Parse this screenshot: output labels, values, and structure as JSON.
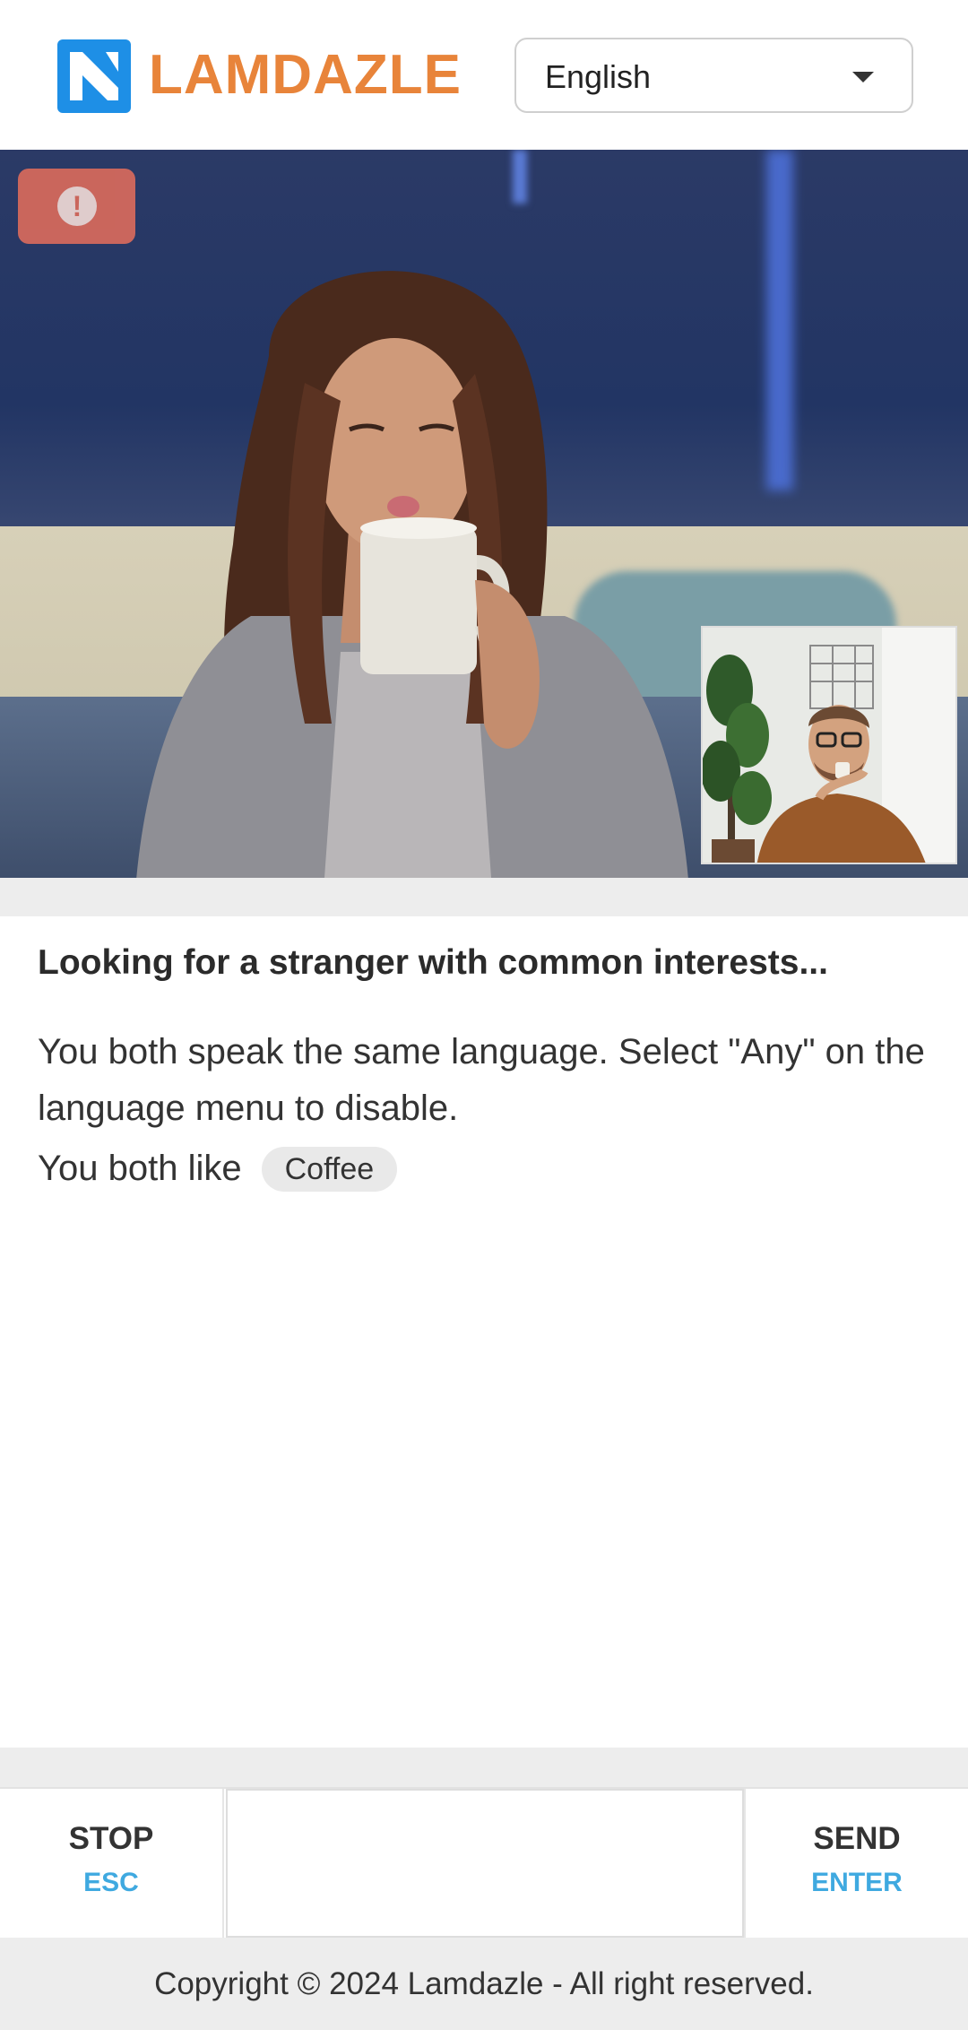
{
  "header": {
    "brand": "LAMDAZLE",
    "language": {
      "selected": "English"
    }
  },
  "video": {
    "report_icon": "exclamation-icon",
    "report_glyph": "!"
  },
  "panel": {
    "status": "Looking for a stranger with common interests...",
    "note": "You both speak the same language. Select \"Any\" on the language menu to disable.",
    "likes_prefix": "You both like",
    "interests": [
      "Coffee"
    ]
  },
  "controls": {
    "stop_label": "STOP",
    "stop_key": "ESC",
    "send_label": "SEND",
    "send_key": "ENTER",
    "message_value": ""
  },
  "footer": {
    "copyright": "Copyright © 2024 Lamdazle - All right reserved."
  },
  "colors": {
    "brand": "#e8843a",
    "logo": "#1e8fe6",
    "accent_key": "#3fa9e0",
    "report": "#d86a5c"
  }
}
